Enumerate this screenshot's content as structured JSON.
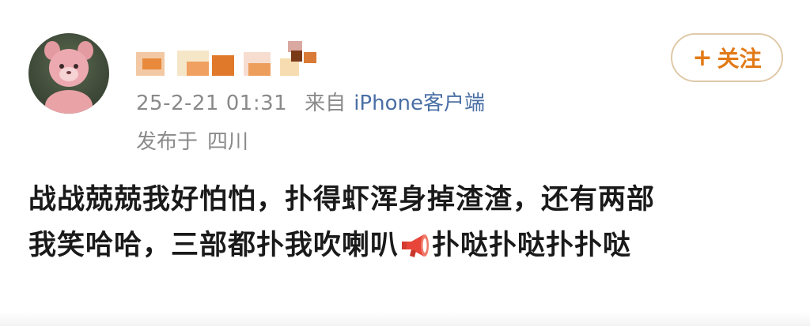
{
  "post": {
    "timestamp": "25-2-21 01:31",
    "from_label": "来自",
    "client": "iPhone客户端",
    "published_in_label": "发布于",
    "location": "四川",
    "text_line1": "战战兢兢我好怕怕，扑得虾浑身掉渣渣，还有两部",
    "text_line2_a": "我笑哈哈，三部都扑我吹喇叭",
    "text_line2_b": "扑哒扑哒扑扑哒"
  },
  "follow": {
    "plus": "+",
    "label": "关注"
  },
  "icons": {
    "avatar": "pink-bear-avatar",
    "megaphone": "megaphone-icon"
  },
  "colors": {
    "accent": "#e27a18",
    "client_link": "#4a6fa5",
    "meta_text": "#8a8a8a"
  }
}
